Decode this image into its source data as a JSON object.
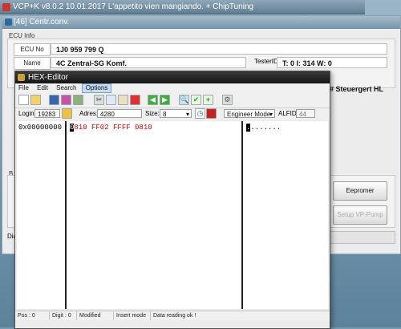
{
  "main_window": {
    "title": "VCP+K v8.0.2 10.01.2017 L'appetito vien mangiando. + ChipTuning"
  },
  "inner_window": {
    "title": "[46] Centr.conv.",
    "ecu_info": {
      "group_label": "ECU Info",
      "ecu_no_label": "ECU No",
      "ecu_no_value": "1J0 959 799 Q",
      "name_label": "Name",
      "name_value": "4C Zentral-SG Komf.",
      "tester_id_label": "TesterID",
      "tester_id_value": "T: 0 I: 314 W: 0",
      "partial_right_text": "# Steuergert HL"
    },
    "partial_group_label": "B",
    "partial_bottom_label": "Dia",
    "buttons": {
      "epromer": "Eepromer",
      "setup": "Setup VP-Pump"
    }
  },
  "hex_editor": {
    "title": "HEX-Editor",
    "menu": [
      "File",
      "Edit",
      "Search",
      "Options"
    ],
    "login_label": "Login:",
    "login_value": "19283",
    "adres_label": "Adres:",
    "adres_value": "4280",
    "size_label": "Size:",
    "size_value": "8",
    "mode_value": "Engineer Mode",
    "alfid_label": "ALFID",
    "alfid_value": "44",
    "address_col": "0x00000000",
    "hex_cursor_char": "0",
    "hex_rest": "810 FF02 FFFF 0810",
    "ascii_cursor_char": ".",
    "ascii_rest": ".......",
    "status": {
      "pos": "Pos : 0",
      "digit": "Digit : 0",
      "modified": "Modified",
      "insert": "Insert mode",
      "reading": "Data reading ok !"
    }
  },
  "colors": {
    "hex_text": "#d40000",
    "title_dark": "#151515",
    "accent_green": "#2e9b2e"
  }
}
